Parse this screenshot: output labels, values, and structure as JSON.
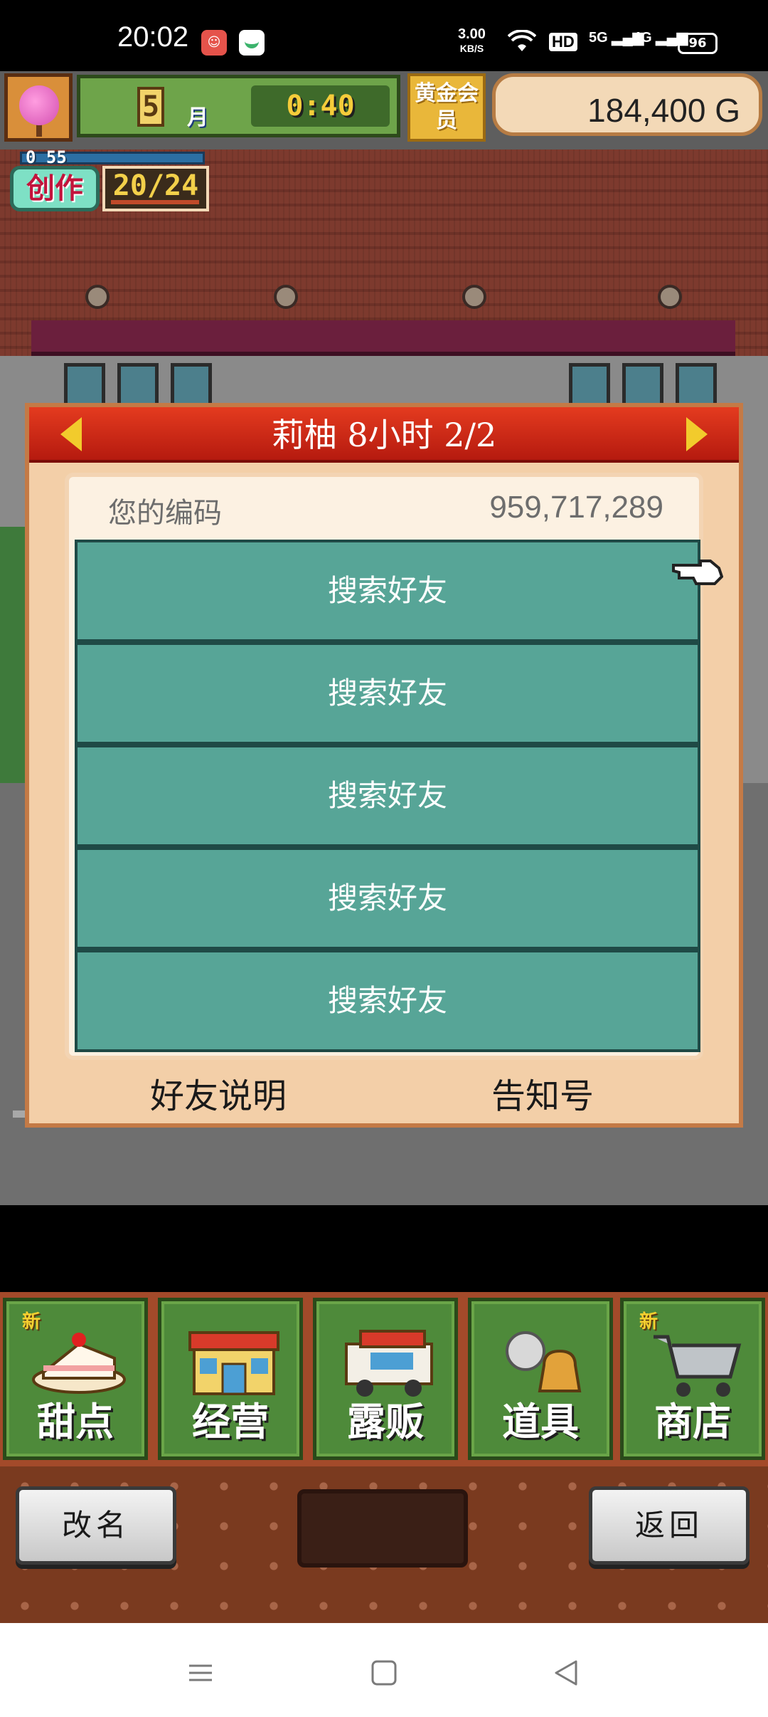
{
  "status_bar": {
    "time": "20:02",
    "speed_value": "3.00",
    "speed_unit": "KB/S",
    "network_hd": "HD",
    "network_5g": "5G",
    "network_4g": "4G",
    "battery": "96"
  },
  "hud": {
    "month_number": "5",
    "month_label": "月",
    "clock": "0:40",
    "gold_member_label": "黄金会员",
    "money": "184,400 G",
    "create_bar_label": "0 55",
    "create_label": "创作",
    "create_count": "20/24"
  },
  "dialog": {
    "title": "莉柚 8小时 2/2",
    "code_label": "您的编码",
    "code_value": "959,717,289",
    "friend_slots": [
      "搜索好友",
      "搜索好友",
      "搜索好友",
      "搜索好友",
      "搜索好友"
    ],
    "friend_help_label": "好友说明",
    "notice_label": "告知号"
  },
  "menu": {
    "items": [
      {
        "label": "甜点",
        "badge": "新",
        "icon": "cake-icon"
      },
      {
        "label": "经营",
        "badge": "",
        "icon": "shop-building-icon"
      },
      {
        "label": "露贩",
        "badge": "",
        "icon": "food-truck-icon"
      },
      {
        "label": "道具",
        "badge": "",
        "icon": "item-bag-icon"
      },
      {
        "label": "商店",
        "badge": "新",
        "icon": "shopping-cart-icon"
      }
    ]
  },
  "controls": {
    "rename_label": "改名",
    "back_label": "返回"
  },
  "colors": {
    "dialog_header": "#c9241a",
    "friend_slot": "#57a597",
    "menu_green": "#4e8a3a",
    "panel_bg": "#fcf1e2"
  }
}
